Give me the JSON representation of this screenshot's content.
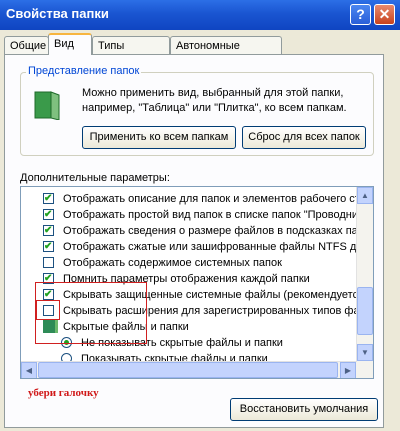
{
  "window": {
    "title": "Свойства папки"
  },
  "titlebar_buttons": {
    "help": "?",
    "close": "✕"
  },
  "tabs": [
    {
      "label": "Общие"
    },
    {
      "label": "Вид"
    },
    {
      "label": "Типы файлов"
    },
    {
      "label": "Автономные файлы"
    }
  ],
  "folder_views": {
    "legend": "Представление папок",
    "description_lines": [
      "Можно применить вид, выбранный для этой папки,",
      "например, \"Таблица\" или \"Плитка\", ко всем папкам."
    ],
    "apply_button": "Применить ко всем папкам",
    "reset_button": "Сброс для всех папок"
  },
  "advanced": {
    "label": "Дополнительные параметры:",
    "items": [
      {
        "text": "Отображать описание для папок и элементов рабочего ст",
        "checked": true
      },
      {
        "text": "Отображать простой вид папок в списке папок \"Проводни",
        "checked": true
      },
      {
        "text": "Отображать сведения о размере файлов в подсказках па",
        "checked": true
      },
      {
        "text": "Отображать сжатые или зашифрованные файлы NTFS др",
        "checked": true
      },
      {
        "text": "Отображать содержимое системных папок",
        "checked": false
      },
      {
        "text": "Помнить параметры отображения каждой папки",
        "checked": true
      },
      {
        "text": "Скрывать защищенные системные файлы (рекомендуетс",
        "checked": true
      },
      {
        "text": "Скрывать расширения для зарегистрированных типов фа",
        "checked": false
      }
    ],
    "hidden_files_folder": "Скрытые файлы и папки",
    "radio_options": [
      {
        "text": "Не показывать скрытые файлы и папки",
        "selected": true
      },
      {
        "text": "Показывать скрытые файлы и папки",
        "selected": false
      }
    ]
  },
  "restore_button": "Восстановить умолчания",
  "annotation": "убери галочку",
  "colors": {
    "titlebar": "#1a55d1",
    "annotation_red": "#d01818",
    "check_green": "#21a121"
  }
}
